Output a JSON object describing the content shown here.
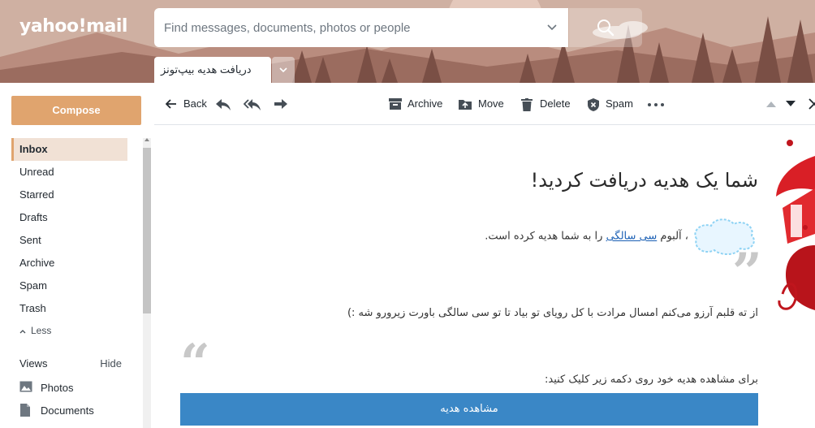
{
  "app": {
    "logo": "yahoo!mail"
  },
  "search": {
    "placeholder": "Find messages, documents, photos or people"
  },
  "tab": {
    "label": "دریافت هدیه بیپ‌تونز"
  },
  "sidebar": {
    "compose_label": "Compose",
    "items": [
      {
        "label": "Inbox",
        "active": true
      },
      {
        "label": "Unread"
      },
      {
        "label": "Starred"
      },
      {
        "label": "Drafts"
      },
      {
        "label": "Sent"
      },
      {
        "label": "Archive"
      },
      {
        "label": "Spam"
      },
      {
        "label": "Trash"
      }
    ],
    "less_label": "Less",
    "views_label": "Views",
    "hide_label": "Hide",
    "views": [
      {
        "label": "Photos",
        "icon": "photo-icon"
      },
      {
        "label": "Documents",
        "icon": "document-icon"
      }
    ]
  },
  "toolbar": {
    "back": "Back",
    "archive": "Archive",
    "move": "Move",
    "delete": "Delete",
    "spam": "Spam"
  },
  "message": {
    "title": "شما یک هدیه دریافت کردید!",
    "line_prefix": "، آلبوم ",
    "album_link": "سی سالگی",
    "line_suffix": " را به شما هدیه کرده است.",
    "wish": "از ته قلبم آرزو می‌کنم امسال مرادت با کل رویای تو بیاد تا تو سی سالگی باورت زیرورو شه :)",
    "instruction": "برای مشاهده هدیه خود روی دکمه زیر کلیک کنید:",
    "button_label": "مشاهده هدیه"
  },
  "colors": {
    "accent": "#e0a46e",
    "header_bg": "#c9a99c",
    "button_blue": "#3a87c6",
    "link": "#1a5fb4"
  }
}
